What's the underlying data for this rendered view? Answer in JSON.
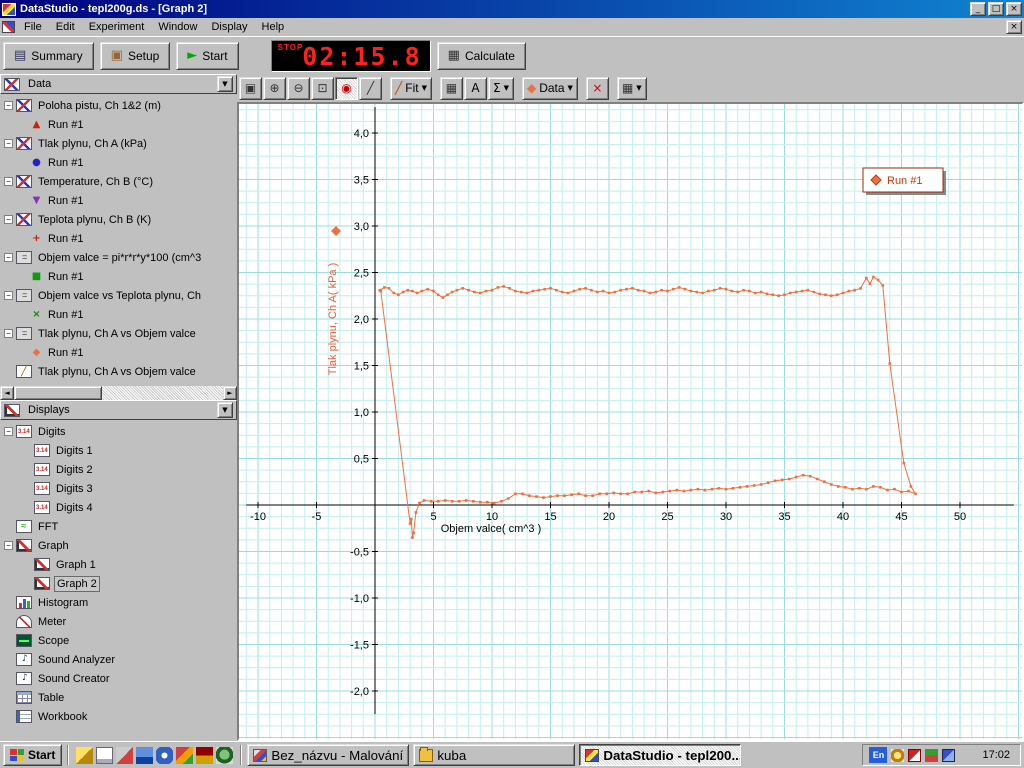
{
  "window": {
    "title": "DataStudio - tepl200g.ds - [Graph 2]"
  },
  "menu": {
    "items": [
      "File",
      "Edit",
      "Experiment",
      "Window",
      "Display",
      "Help"
    ]
  },
  "main_toolbar": {
    "summary_label": "Summary",
    "setup_label": "Setup",
    "start_label": "Start",
    "timer": {
      "stop_label": "STOP",
      "value": "02:15.8"
    },
    "calculate_label": "Calculate"
  },
  "graph_toolbar": {
    "buttons": [
      {
        "name": "scale-to-fit",
        "glyph": "▣",
        "color": "#333333"
      },
      {
        "name": "zoom-in",
        "glyph": "⊕",
        "color": "#333333"
      },
      {
        "name": "zoom-out",
        "glyph": "⊖",
        "color": "#333333"
      },
      {
        "name": "zoom-select",
        "glyph": "⊡",
        "color": "#333333"
      },
      {
        "name": "smart-tool",
        "glyph": "◉",
        "color": "#cc0000",
        "pressed": true
      },
      {
        "name": "slope-tool",
        "glyph": "╱",
        "color": "#333333"
      },
      {
        "name": "fit-menu",
        "glyph": "╱",
        "label": "Fit",
        "color": "#cc4400",
        "dropdown": true,
        "gap": true
      },
      {
        "name": "calculator",
        "glyph": "▦",
        "color": "#333333",
        "gap": true
      },
      {
        "name": "text-note",
        "glyph": "A",
        "color": "#000000"
      },
      {
        "name": "statistics",
        "glyph": "Σ",
        "color": "#000000",
        "dropdown": true
      },
      {
        "name": "data-menu",
        "glyph": "◆",
        "label": "Data",
        "color": "#ee7040",
        "dropdown": true,
        "gap": true
      },
      {
        "name": "delete",
        "glyph": "×",
        "color": "#cc0000",
        "gap": true
      },
      {
        "name": "graph-settings",
        "glyph": "▦",
        "color": "#333333",
        "dropdown": true,
        "gap": true
      }
    ]
  },
  "data_panel": {
    "header": "Data",
    "items": [
      {
        "label": "Poloha pistu, Ch 1&2 (m)",
        "icon": "sensor",
        "runs": [
          {
            "label": "Run #1",
            "marker": "▲",
            "color": "#cc2200"
          }
        ]
      },
      {
        "label": "Tlak plynu, Ch A (kPa)",
        "icon": "sensor",
        "runs": [
          {
            "label": "Run #1",
            "marker": "●",
            "color": "#2222cc"
          }
        ]
      },
      {
        "label": "Temperature, Ch B (°C)",
        "icon": "sensor",
        "runs": [
          {
            "label": "Run #1",
            "marker": "▼",
            "color": "#8833bb"
          }
        ]
      },
      {
        "label": "Teplota plynu, Ch B (K)",
        "icon": "sensor",
        "runs": [
          {
            "label": "Run #1",
            "marker": "+",
            "color": "#cc2200"
          }
        ]
      },
      {
        "label": "Objem valce = pi*r*r*y*100 (cm^3",
        "icon": "calc",
        "runs": [
          {
            "label": "Run #1",
            "marker": "■",
            "color": "#119911"
          }
        ]
      },
      {
        "label": "Objem valce vs Teplota plynu, Ch",
        "icon": "calc",
        "runs": [
          {
            "label": "Run #1",
            "marker": "×",
            "color": "#118811"
          }
        ]
      },
      {
        "label": "Tlak plynu, Ch A vs Objem valce",
        "icon": "calc",
        "runs": [
          {
            "label": "Run #1",
            "marker": "◆",
            "color": "#ee7040"
          }
        ]
      },
      {
        "label": "Tlak plynu, Ch A vs Objem valce",
        "icon": "pen",
        "runs": []
      }
    ]
  },
  "displays_panel": {
    "header": "Displays",
    "items": [
      {
        "label": "Digits",
        "icon": "digits",
        "children": [
          {
            "label": "Digits 1",
            "icon": "digits"
          },
          {
            "label": "Digits 2",
            "icon": "digits"
          },
          {
            "label": "Digits 3",
            "icon": "digits"
          },
          {
            "label": "Digits 4",
            "icon": "digits"
          }
        ]
      },
      {
        "label": "FFT",
        "icon": "fft"
      },
      {
        "label": "Graph",
        "icon": "graph",
        "children": [
          {
            "label": "Graph 1",
            "icon": "graph"
          },
          {
            "label": "Graph 2",
            "icon": "graph",
            "selected": true
          }
        ]
      },
      {
        "label": "Histogram",
        "icon": "histogram"
      },
      {
        "label": "Meter",
        "icon": "meter"
      },
      {
        "label": "Scope",
        "icon": "scope"
      },
      {
        "label": "Sound Analyzer",
        "icon": "sound"
      },
      {
        "label": "Sound Creator",
        "icon": "sound"
      },
      {
        "label": "Table",
        "icon": "table"
      },
      {
        "label": "Workbook",
        "icon": "workbook"
      }
    ]
  },
  "chart_data": {
    "type": "scatter",
    "title": "",
    "xlabel": "Objem valce( cm^3 )",
    "ylabel": "Tlak plynu, Ch A( kPa )",
    "xlim": [
      -11.6,
      55.3
    ],
    "ylim": [
      -2.52,
      4.31
    ],
    "x_ticks": [
      {
        "v": -10,
        "label": "-10"
      },
      {
        "v": -5,
        "label": "-5"
      },
      {
        "v": 5,
        "label": "5"
      },
      {
        "v": 10,
        "label": "10"
      },
      {
        "v": 15,
        "label": "15"
      },
      {
        "v": 20,
        "label": "20"
      },
      {
        "v": 25,
        "label": "25"
      },
      {
        "v": 30,
        "label": "30"
      },
      {
        "v": 35,
        "label": "35"
      },
      {
        "v": 40,
        "label": "40"
      },
      {
        "v": 45,
        "label": "45"
      },
      {
        "v": 50,
        "label": "50"
      }
    ],
    "y_ticks": [
      {
        "v": -2,
        "label": "-2,0"
      },
      {
        "v": -1.5,
        "label": "-1,5"
      },
      {
        "v": -1,
        "label": "-1,0"
      },
      {
        "v": -0.5,
        "label": "-0,5"
      },
      {
        "v": 0.5,
        "label": "0,5"
      },
      {
        "v": 1,
        "label": "1,0"
      },
      {
        "v": 1.5,
        "label": "1,5"
      },
      {
        "v": 2,
        "label": "2,0"
      },
      {
        "v": 2.5,
        "label": "2,5"
      },
      {
        "v": 3,
        "label": "3,0"
      },
      {
        "v": 3.5,
        "label": "3,5"
      },
      {
        "v": 4,
        "label": "4,0"
      }
    ],
    "grid": {
      "minor_color": "#c2eeee",
      "major_color": "#9ddcdc"
    },
    "legend": {
      "label": "Run #1",
      "marker": "diamond",
      "color": "#ee7040",
      "text_color": "#cc3300",
      "position": "top-right"
    },
    "series": [
      {
        "name": "Run #1",
        "color": "#ee7040",
        "marker": "square",
        "points": [
          [
            0.4,
            2.31
          ],
          [
            0.8,
            2.34
          ],
          [
            1.2,
            2.33
          ],
          [
            1.6,
            2.28
          ],
          [
            2,
            2.26
          ],
          [
            2.4,
            2.29
          ],
          [
            2.8,
            2.31
          ],
          [
            3.2,
            2.3
          ],
          [
            3.6,
            2.28
          ],
          [
            4,
            2.3
          ],
          [
            4.5,
            2.32
          ],
          [
            5,
            2.3
          ],
          [
            5.4,
            2.26
          ],
          [
            5.8,
            2.23
          ],
          [
            6.2,
            2.26
          ],
          [
            6.6,
            2.29
          ],
          [
            7,
            2.31
          ],
          [
            7.5,
            2.33
          ],
          [
            8,
            2.31
          ],
          [
            8.5,
            2.29
          ],
          [
            9,
            2.28
          ],
          [
            9.5,
            2.3
          ],
          [
            10,
            2.31
          ],
          [
            10.5,
            2.34
          ],
          [
            11,
            2.35
          ],
          [
            11.5,
            2.33
          ],
          [
            12,
            2.3
          ],
          [
            12.5,
            2.29
          ],
          [
            13,
            2.28
          ],
          [
            13.5,
            2.3
          ],
          [
            14,
            2.31
          ],
          [
            14.5,
            2.32
          ],
          [
            15,
            2.33
          ],
          [
            15.5,
            2.31
          ],
          [
            16,
            2.29
          ],
          [
            16.5,
            2.28
          ],
          [
            17,
            2.3
          ],
          [
            17.5,
            2.32
          ],
          [
            18,
            2.33
          ],
          [
            18.5,
            2.31
          ],
          [
            19,
            2.29
          ],
          [
            19.5,
            2.3
          ],
          [
            20,
            2.28
          ],
          [
            20.5,
            2.29
          ],
          [
            21,
            2.31
          ],
          [
            21.5,
            2.32
          ],
          [
            22,
            2.33
          ],
          [
            22.5,
            2.31
          ],
          [
            23,
            2.3
          ],
          [
            23.5,
            2.28
          ],
          [
            24,
            2.29
          ],
          [
            24.5,
            2.31
          ],
          [
            25,
            2.3
          ],
          [
            25.5,
            2.32
          ],
          [
            26,
            2.34
          ],
          [
            26.5,
            2.32
          ],
          [
            27,
            2.3
          ],
          [
            27.5,
            2.29
          ],
          [
            28,
            2.28
          ],
          [
            28.5,
            2.3
          ],
          [
            29,
            2.31
          ],
          [
            29.5,
            2.33
          ],
          [
            30,
            2.32
          ],
          [
            30.5,
            2.3
          ],
          [
            31,
            2.29
          ],
          [
            31.5,
            2.31
          ],
          [
            32,
            2.3
          ],
          [
            32.5,
            2.28
          ],
          [
            33,
            2.29
          ],
          [
            33.5,
            2.27
          ],
          [
            34,
            2.26
          ],
          [
            34.5,
            2.25
          ],
          [
            35,
            2.26
          ],
          [
            35.5,
            2.28
          ],
          [
            36,
            2.29
          ],
          [
            36.5,
            2.3
          ],
          [
            37,
            2.31
          ],
          [
            37.5,
            2.29
          ],
          [
            38,
            2.27
          ],
          [
            38.5,
            2.26
          ],
          [
            39,
            2.25
          ],
          [
            39.5,
            2.26
          ],
          [
            40,
            2.28
          ],
          [
            40.5,
            2.3
          ],
          [
            41,
            2.31
          ],
          [
            41.5,
            2.33
          ],
          [
            42,
            2.44
          ],
          [
            42.3,
            2.38
          ],
          [
            42.6,
            2.45
          ],
          [
            43,
            2.42
          ],
          [
            43.4,
            2.36
          ],
          [
            44,
            1.52
          ],
          [
            45.2,
            0.45
          ],
          [
            45.8,
            0.2
          ],
          [
            46.2,
            0.12
          ],
          [
            45.6,
            0.15
          ],
          [
            45,
            0.14
          ],
          [
            44.4,
            0.17
          ],
          [
            43.8,
            0.16
          ],
          [
            43.2,
            0.19
          ],
          [
            42.6,
            0.2
          ],
          [
            42,
            0.17
          ],
          [
            41.4,
            0.18
          ],
          [
            40.8,
            0.17
          ],
          [
            40.2,
            0.19
          ],
          [
            39.6,
            0.2
          ],
          [
            39,
            0.22
          ],
          [
            38.4,
            0.25
          ],
          [
            37.8,
            0.28
          ],
          [
            37.2,
            0.31
          ],
          [
            36.6,
            0.32
          ],
          [
            36,
            0.3
          ],
          [
            35.4,
            0.28
          ],
          [
            34.8,
            0.27
          ],
          [
            34.2,
            0.26
          ],
          [
            33.6,
            0.24
          ],
          [
            33,
            0.22
          ],
          [
            32.4,
            0.21
          ],
          [
            31.8,
            0.2
          ],
          [
            31.2,
            0.19
          ],
          [
            30.6,
            0.18
          ],
          [
            30,
            0.17
          ],
          [
            29.4,
            0.18
          ],
          [
            28.8,
            0.17
          ],
          [
            28.2,
            0.16
          ],
          [
            27.6,
            0.17
          ],
          [
            27,
            0.16
          ],
          [
            26.4,
            0.15
          ],
          [
            25.8,
            0.16
          ],
          [
            25.2,
            0.15
          ],
          [
            24.6,
            0.14
          ],
          [
            24,
            0.13
          ],
          [
            23.4,
            0.15
          ],
          [
            22.8,
            0.14
          ],
          [
            22.2,
            0.14
          ],
          [
            21.6,
            0.12
          ],
          [
            21,
            0.12
          ],
          [
            20.4,
            0.13
          ],
          [
            19.8,
            0.12
          ],
          [
            19.2,
            0.12
          ],
          [
            18.6,
            0.1
          ],
          [
            18,
            0.1
          ],
          [
            17.4,
            0.12
          ],
          [
            16.8,
            0.11
          ],
          [
            16.2,
            0.1
          ],
          [
            15.6,
            0.1
          ],
          [
            15,
            0.09
          ],
          [
            14.4,
            0.08
          ],
          [
            13.8,
            0.09
          ],
          [
            13.2,
            0.1
          ],
          [
            12.6,
            0.12
          ],
          [
            12,
            0.12
          ],
          [
            11.4,
            0.07
          ],
          [
            10.8,
            0.04
          ],
          [
            10.2,
            0.02
          ],
          [
            9.6,
            0.03
          ],
          [
            9,
            0.03
          ],
          [
            8.4,
            0.04
          ],
          [
            7.8,
            0.05
          ],
          [
            7.2,
            0.04
          ],
          [
            6.6,
            0.04
          ],
          [
            6,
            0.05
          ],
          [
            5.4,
            0.04
          ],
          [
            4.8,
            0.04
          ],
          [
            4.2,
            0.05
          ],
          [
            3.8,
            0.02
          ],
          [
            3.5,
            -0.08
          ],
          [
            3.3,
            -0.3
          ],
          [
            3.2,
            -0.35
          ],
          [
            3.1,
            -0.15
          ],
          [
            3,
            -0.2
          ],
          [
            0.5,
            2.3
          ]
        ]
      }
    ]
  },
  "taskbar": {
    "start_label": "Start",
    "tasks": [
      {
        "label": "Bez_názvu - Malování",
        "icon": "paint"
      },
      {
        "label": "kuba",
        "icon": "folder"
      },
      {
        "label": "DataStudio - tepl200...",
        "icon": "datastudio",
        "active": true
      }
    ],
    "tray": {
      "lang": "En",
      "clock": "17:02"
    }
  }
}
